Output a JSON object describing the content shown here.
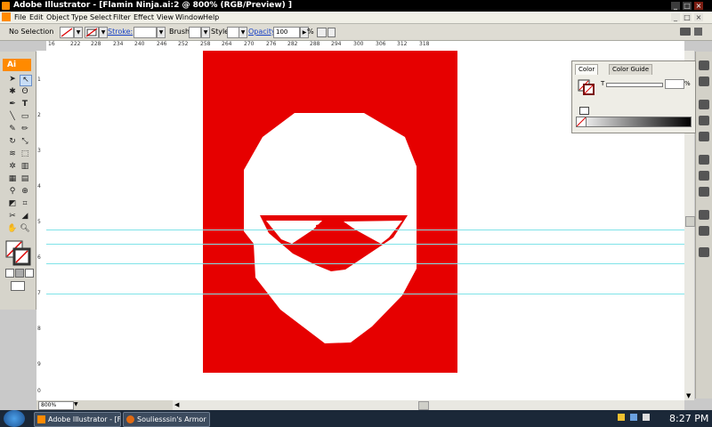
{
  "window": {
    "title": "Adobe Illustrator - [Flamin Ninja.ai:2 @ 800% (RGB/Preview) ]"
  },
  "menu": [
    "File",
    "Edit",
    "Object",
    "Type",
    "Select",
    "Filter",
    "Effect",
    "View",
    "Window",
    "Help"
  ],
  "control_bar": {
    "selection_label": "No Selection",
    "stroke_label": "Stroke:",
    "brush_label": "Brush:",
    "style_label": "Style:",
    "opacity_label": "Opacity:",
    "opacity_value": "100",
    "percent": "%"
  },
  "toolbox": {
    "badge": "Ai"
  },
  "ruler_top": [
    "16",
    "222",
    "228",
    "234",
    "240",
    "246",
    "252",
    "258",
    "264",
    "270",
    "276",
    "282",
    "288",
    "294",
    "300",
    "306",
    "312",
    "318"
  ],
  "ruler_left": [
    "1",
    "2",
    "3",
    "4",
    "5",
    "6",
    "7",
    "8",
    "9",
    "0"
  ],
  "color_panel": {
    "tab_color": "Color",
    "tab_guide": "Color Guide",
    "channel_label": "T",
    "percent": "%"
  },
  "status": {
    "zoom": "800%"
  },
  "taskbar": {
    "items": [
      "Adobe Illustrator - [Fl...",
      "Souliesssin's Armor Pr..."
    ],
    "clock": "8:27 PM"
  },
  "artwork": {
    "background_color": "#e60000",
    "mask_color": "#ffffff"
  }
}
